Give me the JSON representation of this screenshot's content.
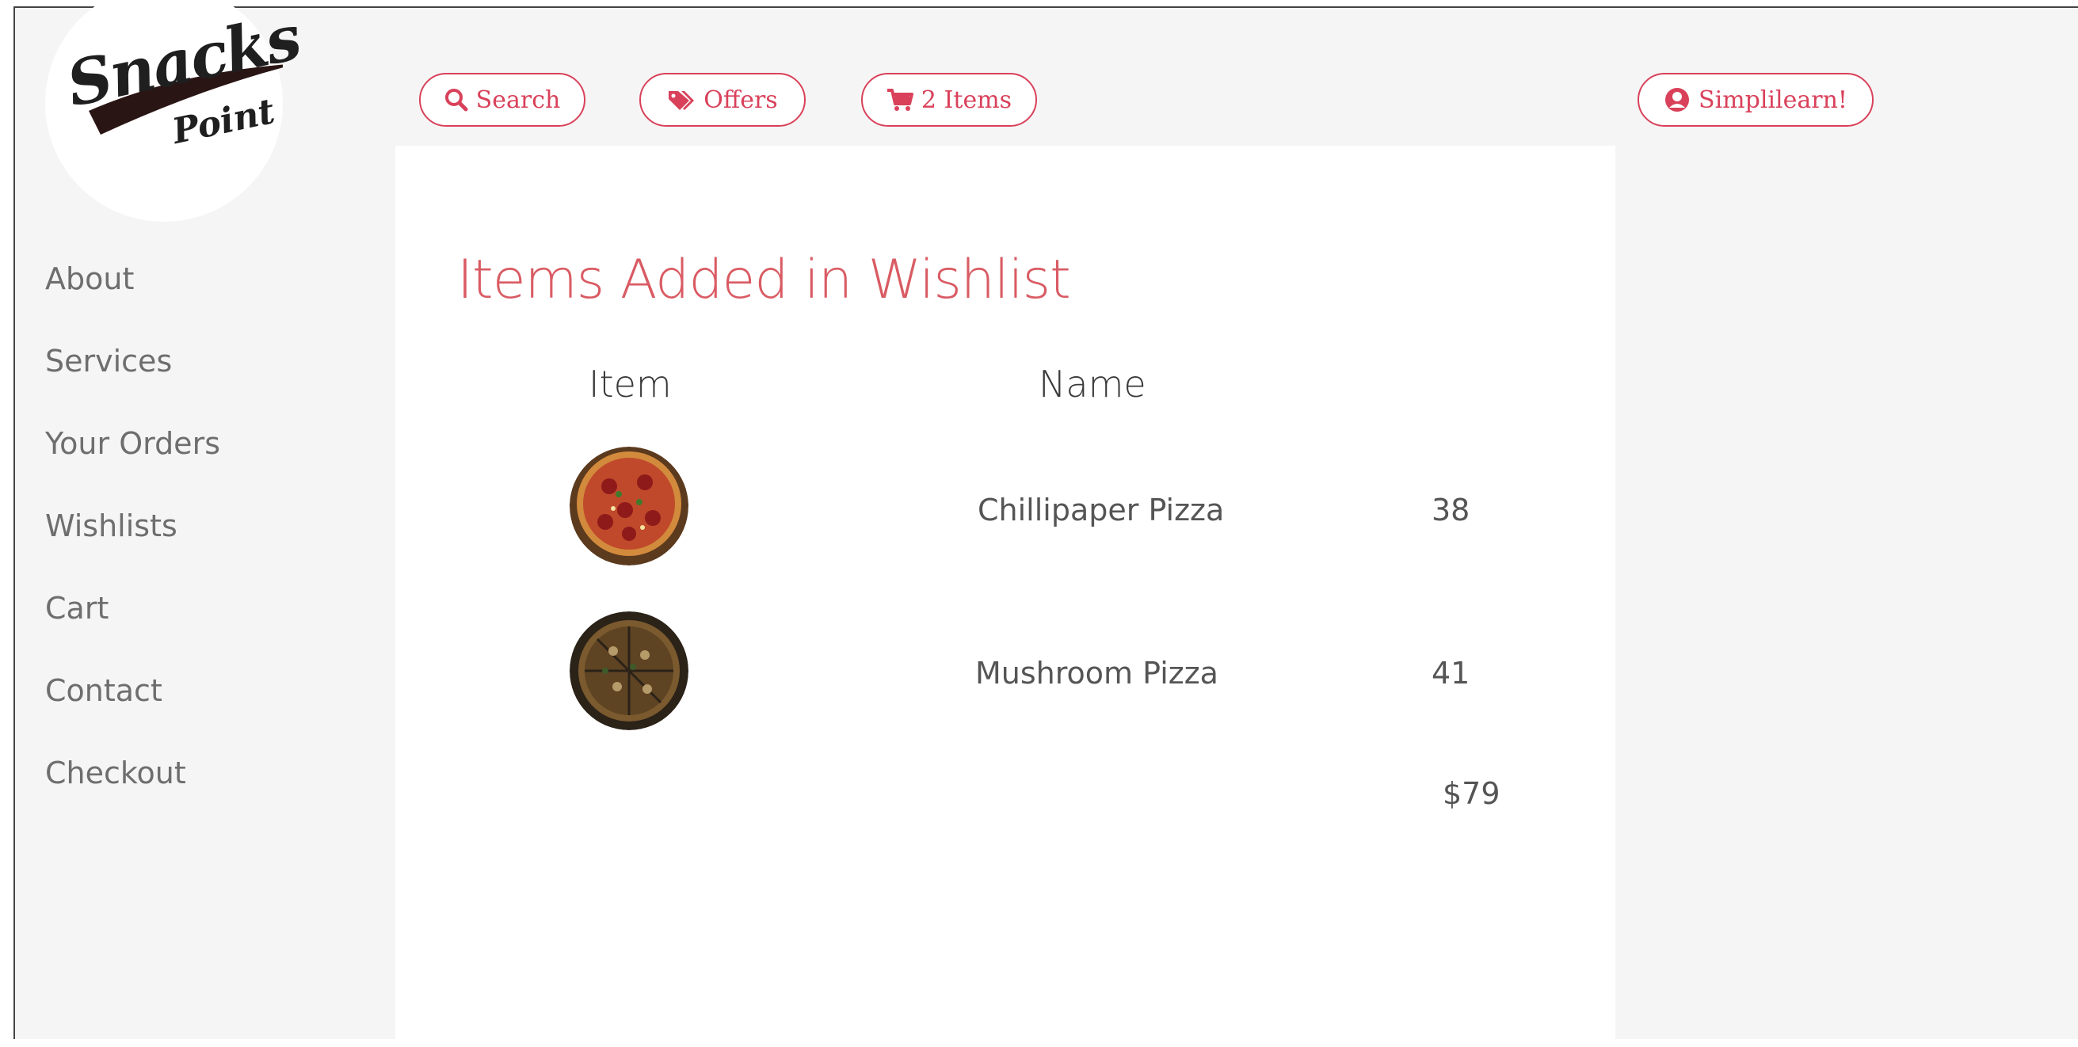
{
  "logo": {
    "line1": "Snacks",
    "line2": "Point"
  },
  "sidebar": {
    "items": [
      {
        "label": "About"
      },
      {
        "label": "Services"
      },
      {
        "label": "Your Orders"
      },
      {
        "label": "Wishlists"
      },
      {
        "label": "Cart"
      },
      {
        "label": "Contact"
      },
      {
        "label": "Checkout"
      }
    ]
  },
  "topbar": {
    "search_label": "Search",
    "offers_label": "Offers",
    "cart_label": "2 Items",
    "user_label": "Simplilearn!"
  },
  "wishlist": {
    "title": "Items Added in Wishlist",
    "columns": {
      "item": "Item",
      "name": "Name"
    },
    "rows": [
      {
        "name": "Chillipaper Pizza",
        "price": "38"
      },
      {
        "name": "Mushroom Pizza",
        "price": "41"
      }
    ],
    "total": "$79"
  },
  "colors": {
    "accent": "#d9415a",
    "title": "#d95b63"
  }
}
